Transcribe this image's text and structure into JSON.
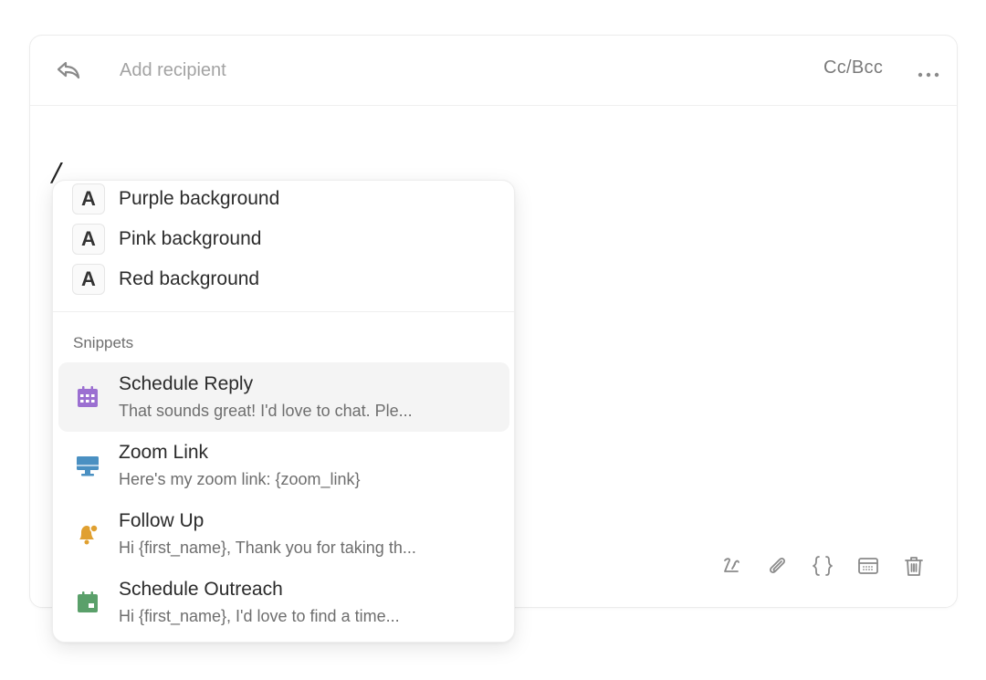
{
  "header": {
    "recipient_placeholder": "Add recipient",
    "ccbcc_label": "Cc/Bcc"
  },
  "editor": {
    "content": "/"
  },
  "menu": {
    "format_items": [
      {
        "badge": "A",
        "label": "Purple background"
      },
      {
        "badge": "A",
        "label": "Pink background"
      },
      {
        "badge": "A",
        "label": "Red background"
      }
    ],
    "snippets_section_label": "Snippets",
    "snippets": [
      {
        "icon": "calendar-grid-icon",
        "icon_color": "#9b6fd1",
        "title": "Schedule Reply",
        "preview": "That sounds great! I'd love to chat. Ple...",
        "active": true
      },
      {
        "icon": "monitor-icon",
        "icon_color": "#4a90c2",
        "title": "Zoom Link",
        "preview": "Here's my zoom link: {zoom_link}"
      },
      {
        "icon": "bell-icon",
        "icon_color": "#e0a030",
        "title": "Follow Up",
        "preview": "Hi {first_name}, Thank you for taking th..."
      },
      {
        "icon": "calendar-icon",
        "icon_color": "#5aa06a",
        "title": "Schedule Outreach",
        "preview": "Hi {first_name}, I'd love to find a time..."
      }
    ]
  },
  "toolbar": {
    "icons": [
      "signature-icon",
      "paperclip-icon",
      "braces-icon",
      "calendar-window-icon",
      "trash-icon"
    ]
  },
  "colors": {
    "active_row_bg": "#f4f4f4",
    "icon_gray": "#8a8a8a"
  }
}
